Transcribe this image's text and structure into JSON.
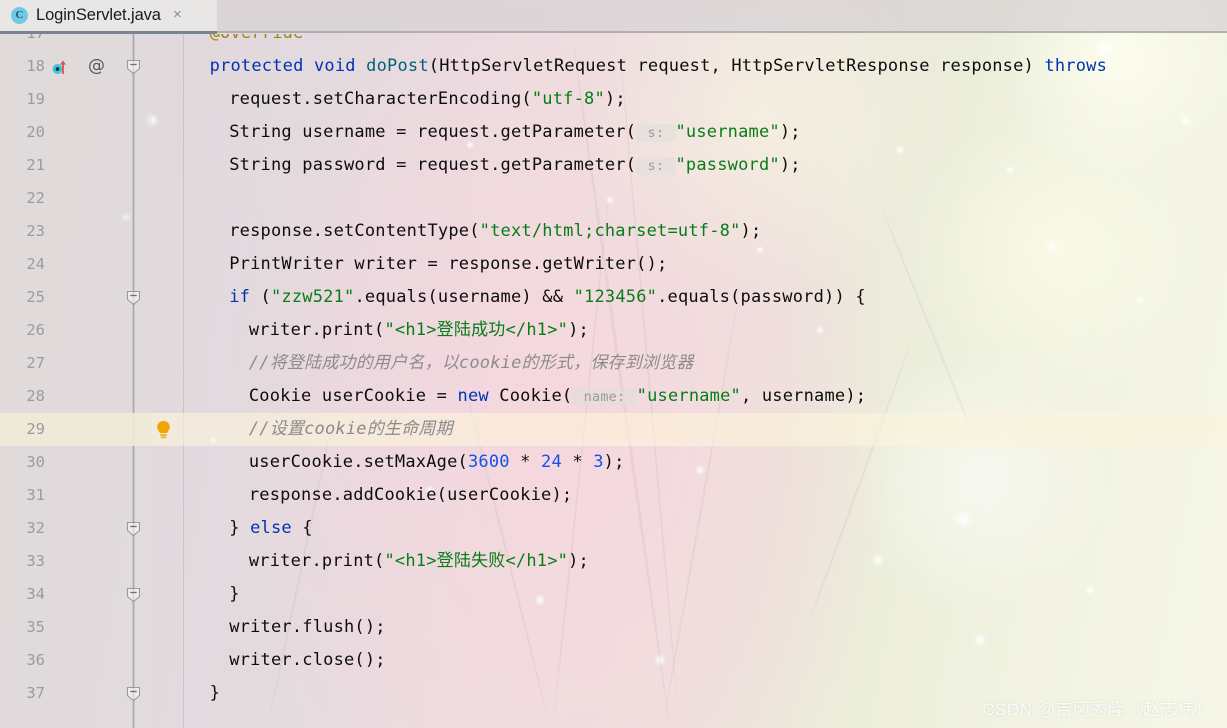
{
  "tab": {
    "icon": "java-class-icon",
    "label": "LoginServlet.java",
    "close": "×"
  },
  "watermark": "CSDN @吉冈秀隆（赵志伟）",
  "gutter": {
    "override_icon": "override-method-icon",
    "annotation_marker": "@",
    "fold_icon": "fold-collapse-icon",
    "intention_bulb": "intention-bulb-icon"
  },
  "colors": {
    "keyword": "#0033b3",
    "annotation": "#9e880d",
    "method": "#00627a",
    "string": "#067d17",
    "number": "#1750eb",
    "comment": "#8c8c8c",
    "param_hint": "#9a9a9a",
    "tab_active_underline": "#7b8290",
    "class_icon_bg": "#6fc9e3",
    "bulb": "#f0a500",
    "override_arrow": "#e05050"
  },
  "editor": {
    "caret_line": 29,
    "first_visible_line": 17,
    "last_visible_line": 37,
    "lines": [
      {
        "num": 17,
        "indent": 1,
        "tokens": [
          {
            "t": "@Override",
            "c": "ann"
          }
        ]
      },
      {
        "num": 18,
        "indent": 1,
        "override": true,
        "annotation": "@",
        "fold": true,
        "tokens": [
          {
            "t": "protected ",
            "c": "kw"
          },
          {
            "t": "void ",
            "c": "kw"
          },
          {
            "t": "doPost",
            "c": "meth"
          },
          {
            "t": "(HttpServletRequest request, HttpServletResponse response) ",
            "c": ""
          },
          {
            "t": "throws",
            "c": "kw"
          }
        ]
      },
      {
        "num": 19,
        "indent": 2,
        "tokens": [
          {
            "t": "request.setCharacterEncoding(",
            "c": ""
          },
          {
            "t": "\"utf-8\"",
            "c": "str"
          },
          {
            "t": ");",
            "c": ""
          }
        ]
      },
      {
        "num": 20,
        "indent": 2,
        "tokens": [
          {
            "t": "String username = request.getParameter(",
            "c": ""
          },
          {
            "t": " s: ",
            "c": "hint"
          },
          {
            "t": "\"username\"",
            "c": "str"
          },
          {
            "t": ");",
            "c": ""
          }
        ]
      },
      {
        "num": 21,
        "indent": 2,
        "tokens": [
          {
            "t": "String password = request.getParameter(",
            "c": ""
          },
          {
            "t": " s: ",
            "c": "hint"
          },
          {
            "t": "\"password\"",
            "c": "str"
          },
          {
            "t": ");",
            "c": ""
          }
        ]
      },
      {
        "num": 22,
        "indent": 0,
        "tokens": []
      },
      {
        "num": 23,
        "indent": 2,
        "tokens": [
          {
            "t": "response.setContentType(",
            "c": ""
          },
          {
            "t": "\"text/html;charset=utf-8\"",
            "c": "str"
          },
          {
            "t": ");",
            "c": ""
          }
        ]
      },
      {
        "num": 24,
        "indent": 2,
        "tokens": [
          {
            "t": "PrintWriter writer = response.getWriter();",
            "c": ""
          }
        ]
      },
      {
        "num": 25,
        "indent": 2,
        "fold": true,
        "tokens": [
          {
            "t": "if ",
            "c": "kw"
          },
          {
            "t": "(",
            "c": ""
          },
          {
            "t": "\"zzw521\"",
            "c": "str"
          },
          {
            "t": ".equals(username) && ",
            "c": ""
          },
          {
            "t": "\"123456\"",
            "c": "str"
          },
          {
            "t": ".equals(password)) {",
            "c": ""
          }
        ]
      },
      {
        "num": 26,
        "indent": 3,
        "tokens": [
          {
            "t": "writer.print(",
            "c": ""
          },
          {
            "t": "\"<h1>登陆成功</h1>\"",
            "c": "str"
          },
          {
            "t": ");",
            "c": ""
          }
        ]
      },
      {
        "num": 27,
        "indent": 3,
        "tokens": [
          {
            "t": "//将登陆成功的用户名，以cookie的形式，保存到浏览器",
            "c": "cmt"
          }
        ]
      },
      {
        "num": 28,
        "indent": 3,
        "tokens": [
          {
            "t": "Cookie userCookie = ",
            "c": ""
          },
          {
            "t": "new ",
            "c": "kw"
          },
          {
            "t": "Cookie(",
            "c": ""
          },
          {
            "t": " name: ",
            "c": "hint"
          },
          {
            "t": "\"username\"",
            "c": "str"
          },
          {
            "t": ", username);",
            "c": ""
          }
        ]
      },
      {
        "num": 29,
        "indent": 3,
        "bulb": true,
        "caret": true,
        "tokens": [
          {
            "t": "//设置cookie的生命周期",
            "c": "cmt"
          }
        ]
      },
      {
        "num": 30,
        "indent": 3,
        "tokens": [
          {
            "t": "userCookie.setMaxAge(",
            "c": ""
          },
          {
            "t": "3600",
            "c": "num"
          },
          {
            "t": " * ",
            "c": ""
          },
          {
            "t": "24",
            "c": "num"
          },
          {
            "t": " * ",
            "c": ""
          },
          {
            "t": "3",
            "c": "num"
          },
          {
            "t": ");",
            "c": ""
          }
        ]
      },
      {
        "num": 31,
        "indent": 3,
        "tokens": [
          {
            "t": "response.addCookie(userCookie);",
            "c": ""
          }
        ]
      },
      {
        "num": 32,
        "indent": 2,
        "fold": true,
        "tokens": [
          {
            "t": "} ",
            "c": ""
          },
          {
            "t": "else",
            "c": "kw"
          },
          {
            "t": " {",
            "c": ""
          }
        ]
      },
      {
        "num": 33,
        "indent": 3,
        "tokens": [
          {
            "t": "writer.print(",
            "c": ""
          },
          {
            "t": "\"<h1>登陆失败</h1>\"",
            "c": "str"
          },
          {
            "t": ");",
            "c": ""
          }
        ]
      },
      {
        "num": 34,
        "indent": 2,
        "fold": true,
        "tokens": [
          {
            "t": "}",
            "c": ""
          }
        ]
      },
      {
        "num": 35,
        "indent": 2,
        "tokens": [
          {
            "t": "writer.flush();",
            "c": ""
          }
        ]
      },
      {
        "num": 36,
        "indent": 2,
        "tokens": [
          {
            "t": "writer.close();",
            "c": ""
          }
        ]
      },
      {
        "num": 37,
        "indent": 1,
        "fold": true,
        "tokens": [
          {
            "t": "}",
            "c": ""
          }
        ]
      }
    ]
  }
}
